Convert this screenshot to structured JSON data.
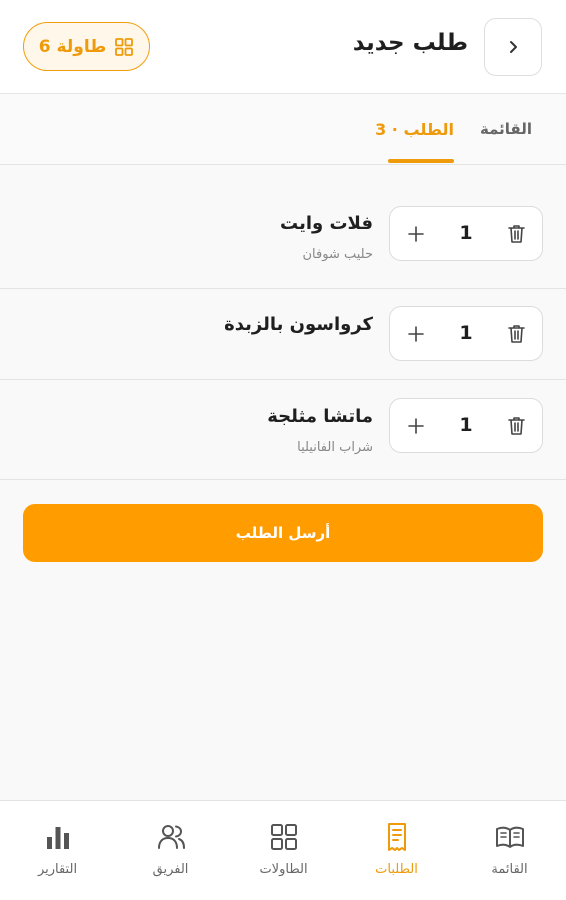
{
  "header": {
    "title": "طلب جديد",
    "table_badge": "طاولة 6"
  },
  "tabs": [
    {
      "label": "القائمة",
      "active": false
    },
    {
      "label": "الطلب · 3",
      "active": true
    }
  ],
  "order_items": [
    {
      "name": "فلات وايت",
      "note": "حليب شوفان",
      "quantity": "1"
    },
    {
      "name": "كرواسون بالزبدة",
      "note": "",
      "quantity": "1"
    },
    {
      "name": "ماتشا مثلجة",
      "note": "شراب الفانيليا",
      "quantity": "1"
    }
  ],
  "submit_label": "أرسل الطلب",
  "bottom_nav": [
    {
      "label": "القائمة",
      "icon": "book-icon",
      "active": false
    },
    {
      "label": "الطلبات",
      "icon": "receipt-icon",
      "active": true
    },
    {
      "label": "الطاولات",
      "icon": "grid-icon",
      "active": false
    },
    {
      "label": "الفريق",
      "icon": "users-icon",
      "active": false
    },
    {
      "label": "التقارير",
      "icon": "bar-chart-icon",
      "active": false
    }
  ],
  "colors": {
    "accent": "#ff9c00",
    "accent_text": "#ef9a0a",
    "text": "#1f1f1f",
    "muted": "#888888"
  }
}
